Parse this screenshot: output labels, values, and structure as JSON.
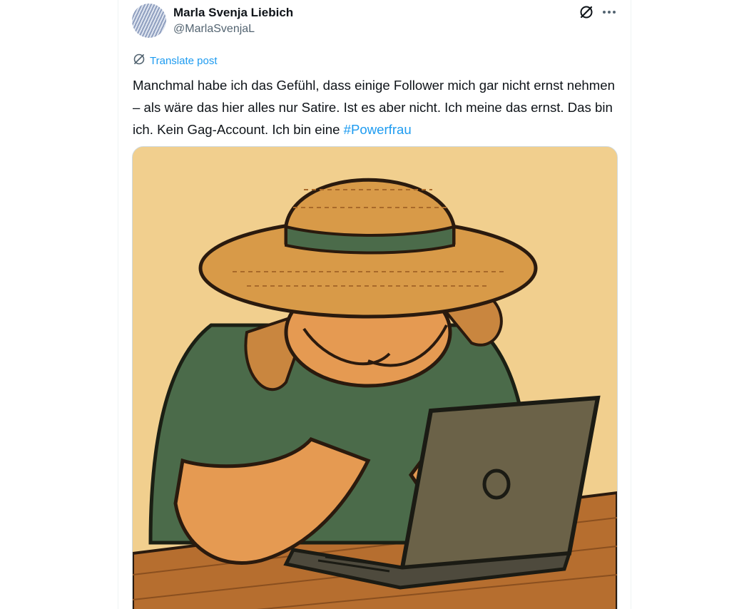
{
  "post": {
    "author_name": "Marla Svenja Liebich",
    "author_handle": "@MarlaSvenjaL",
    "translate_label": "Translate post",
    "text_main": "Manchmal habe ich das Gefühl, dass einige Follower mich gar nicht ernst nehmen – als wäre das hier alles nur Satire. Ist es aber nicht. Ich meine das ernst. Das bin ich. Kein Gag-Account. Ich bin eine ",
    "hashtag": "#Powerfrau"
  },
  "icons": {
    "grok": "grok-icon",
    "more": "more-icon",
    "translate": "translate-icon"
  },
  "colors": {
    "link": "#1d9bf0",
    "text": "#0f1419",
    "secondary_text": "#536471",
    "image_background": "#f1cf8e"
  }
}
